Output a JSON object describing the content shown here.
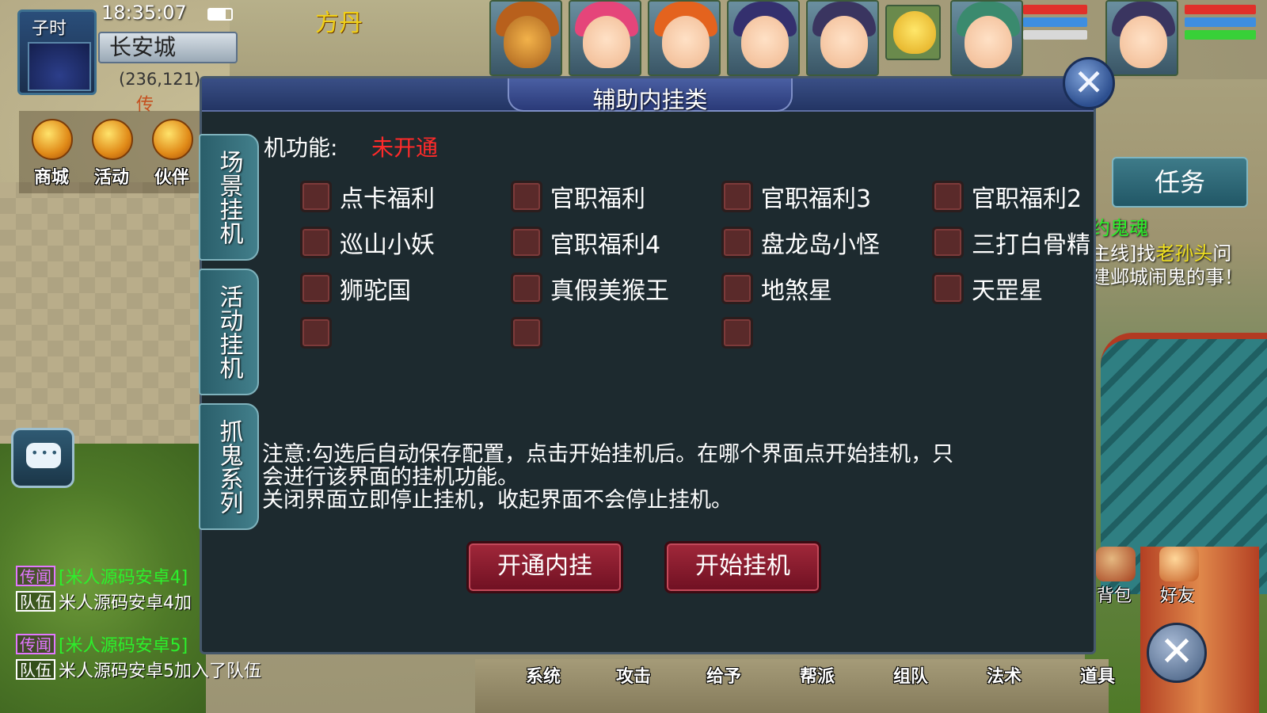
{
  "status": {
    "shichen": "子时",
    "time": "18:35:07",
    "city": "长安城",
    "coords": "(236,121)",
    "map_ribbon": "传"
  },
  "shortcuts": [
    {
      "label": "商城",
      "icon": "mall-icon"
    },
    {
      "label": "活动",
      "icon": "activity-icon"
    },
    {
      "label": "伙伴",
      "icon": "partner-icon"
    }
  ],
  "npc_name": "方丹",
  "dialog": {
    "title": "辅助内挂类",
    "close_icon": "close-icon",
    "tabs": [
      {
        "label": "场景挂机"
      },
      {
        "label": "活动挂机"
      },
      {
        "label": "抓鬼系列"
      }
    ],
    "function_label": "机功能:",
    "function_status": "未开通",
    "options": [
      [
        "点卡福利",
        "官职福利",
        "官职福利3",
        "官职福利2"
      ],
      [
        "巡山小妖",
        "官职福利4",
        "盘龙岛小怪",
        "三打白骨精"
      ],
      [
        "狮驼国",
        "真假美猴王",
        "地煞星",
        "天罡星"
      ],
      [
        "",
        "",
        ""
      ]
    ],
    "notice_lines": [
      "注意:勾选后自动保存配置，点击开始挂机后。在哪个界面点开始挂机，只",
      "会进行该界面的挂机功能。",
      "关闭界面立即停止挂机，收起界面不会停止挂机。"
    ],
    "buttons": {
      "activate": "开通内挂",
      "start": "开始挂机"
    }
  },
  "right_panel": {
    "task_label": "任务",
    "task_title": "约鬼魂",
    "task_line1_prefix": "主线]找",
    "task_line1_npc": "老孙头",
    "task_line1_suffix": "问",
    "task_line2": "建邺城闹鬼的事！",
    "icons": [
      {
        "label": "背包",
        "icon": "bag-icon"
      },
      {
        "label": "好友",
        "icon": "friends-icon"
      }
    ]
  },
  "bottom_menu": [
    "系统",
    "攻击",
    "给予",
    "帮派",
    "组队",
    "法术",
    "道具"
  ],
  "chat": [
    {
      "channel": "传闻",
      "kind": "rumor",
      "text": "[米人源码安卓4]",
      "color": "green"
    },
    {
      "channel": "队伍",
      "kind": "team",
      "text": "米人源码安卓4加",
      "color": "white"
    },
    {
      "channel": "传闻",
      "kind": "rumor",
      "text": "[米人源码安卓5]",
      "color": "green"
    },
    {
      "channel": "队伍",
      "kind": "team",
      "text": "米人源码安卓5加入了队伍",
      "color": "white"
    }
  ],
  "colors": {
    "status_red": "#ff2a2a",
    "button_red": "#8a1a2e",
    "dialog_bg": "#1d2a2f",
    "tab_teal": "#2f6b78",
    "rumor_purple": "#e277ff",
    "chat_green": "#2cf02c"
  }
}
